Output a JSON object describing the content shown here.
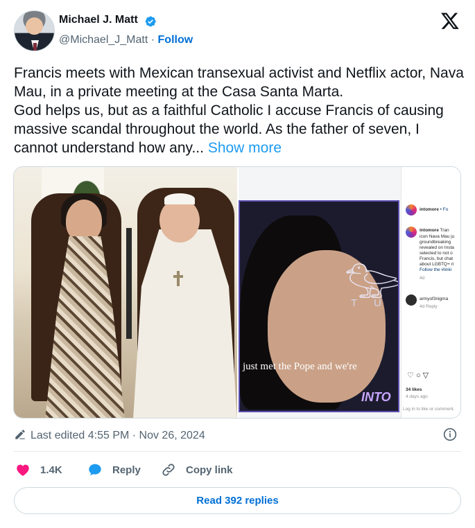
{
  "author": {
    "name": "Michael J. Matt",
    "handle": "@Michael_J_Matt",
    "separator": "·",
    "follow_label": "Follow",
    "verified_color": "#1d9bf0"
  },
  "tweet": {
    "text_line1": "Francis meets with Mexican transexual activist and Netflix actor, Nava Mau, in a private meeting at the Casa Santa Marta.",
    "text_line2": "God helps us, but as a faithful Catholic I accuse Francis of causing massive scandal throughout the world. As the father of seven, I cannot understand how any...",
    "show_more": "Show more"
  },
  "media": {
    "right": {
      "video_caption": "just met the Pope and we're",
      "video_brand": "INTO",
      "video_sign_letters": "T U",
      "ig_post_author": "intomore",
      "ig_post_dot": "•",
      "ig_follow_short": "Fo",
      "ig_comment_author": "intomore",
      "ig_comment_lines": [
        "icon Nava Mau ju",
        "groundbreaking",
        "revealed on Insta",
        "selected to not o",
        "Francis, but chat",
        "about LGBTQ+ ri",
        "Follow the #linki"
      ],
      "ig_comment_tran": "Tran",
      "ig_comment_age": "4d",
      "ig_reply_author": "armyof3nigma",
      "ig_reply_meta": "4d  Reply",
      "ig_likes": "34 likes",
      "ig_date": "4 days ago",
      "ig_login": "Log in to like or comment."
    }
  },
  "meta": {
    "last_edited": "Last edited 4:55 PM · Nov 26, 2024"
  },
  "actions": {
    "likes": "1.4K",
    "reply": "Reply",
    "copy_link": "Copy link",
    "like_color": "#f91880"
  },
  "read_replies": "Read 392 replies"
}
